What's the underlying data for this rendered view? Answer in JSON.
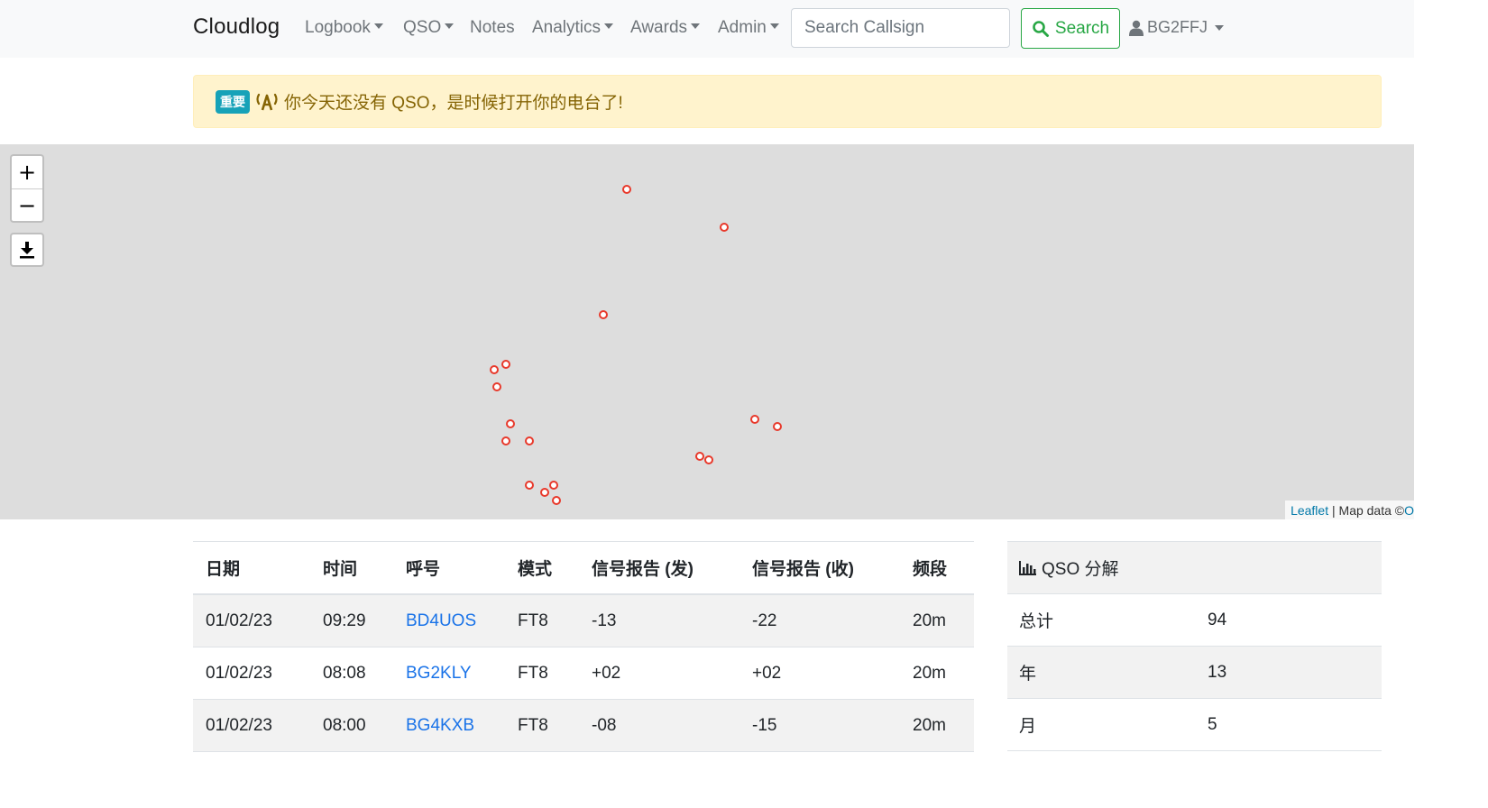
{
  "navbar": {
    "brand": "Cloudlog",
    "items": [
      {
        "label": "Logbook",
        "dropdown": true
      },
      {
        "label": "QSO",
        "dropdown": true
      },
      {
        "label": "Notes",
        "dropdown": false
      },
      {
        "label": "Analytics",
        "dropdown": true
      },
      {
        "label": "Awards",
        "dropdown": true
      },
      {
        "label": "Admin",
        "dropdown": true
      }
    ],
    "search_placeholder": "Search Callsign",
    "search_button": "Search",
    "user": "BG2FFJ"
  },
  "alert": {
    "badge": "重要",
    "message": "你今天还没有 QSO，是时候打开你的电台了!"
  },
  "map": {
    "attribution_link": "Leaflet",
    "attribution_text": "| Map data © ",
    "attribution_trail": "O",
    "marker_color": "#e8392b",
    "marker_count": 18
  },
  "qso_table": {
    "headers": [
      "日期",
      "时间",
      "呼号",
      "模式",
      "信号报告 (发)",
      "信号报告 (收)",
      "频段"
    ],
    "rows": [
      {
        "date": "01/02/23",
        "time": "09:29",
        "call": "BD4UOS",
        "mode": "FT8",
        "rst_sent": "-13",
        "rst_rcvd": "-22",
        "band": "20m"
      },
      {
        "date": "01/02/23",
        "time": "08:08",
        "call": "BG2KLY",
        "mode": "FT8",
        "rst_sent": "+02",
        "rst_rcvd": "+02",
        "band": "20m"
      },
      {
        "date": "01/02/23",
        "time": "08:00",
        "call": "BG4KXB",
        "mode": "FT8",
        "rst_sent": "-08",
        "rst_rcvd": "-15",
        "band": "20m"
      }
    ]
  },
  "breakdown": {
    "title": "QSO 分解",
    "rows": [
      {
        "label": "总计",
        "value": "94"
      },
      {
        "label": "年",
        "value": "13"
      },
      {
        "label": "月",
        "value": "5"
      }
    ]
  },
  "colors": {
    "link": "#1a73e8",
    "success": "#28a745",
    "warning_bg": "#fff3cd",
    "warning_text": "#856404",
    "badge": "#17a2b8"
  }
}
